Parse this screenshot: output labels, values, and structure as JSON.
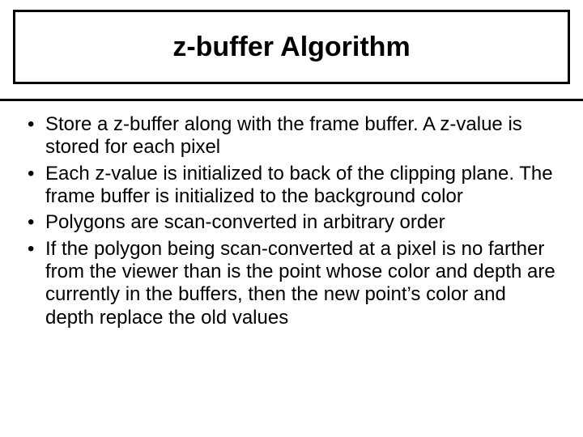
{
  "title": "z-buffer Algorithm",
  "bullets": [
    "Store a z-buffer along with the frame buffer. A z-value is stored for each pixel",
    "Each z-value is initialized to back of the clipping plane. The frame buffer is initialized to the background color",
    "Polygons are scan-converted in arbitrary order",
    "If the polygon being scan-converted at a pixel is no farther from the viewer than is the point whose color and depth are currently in the buffers, then the new point’s color and depth replace the old values"
  ]
}
